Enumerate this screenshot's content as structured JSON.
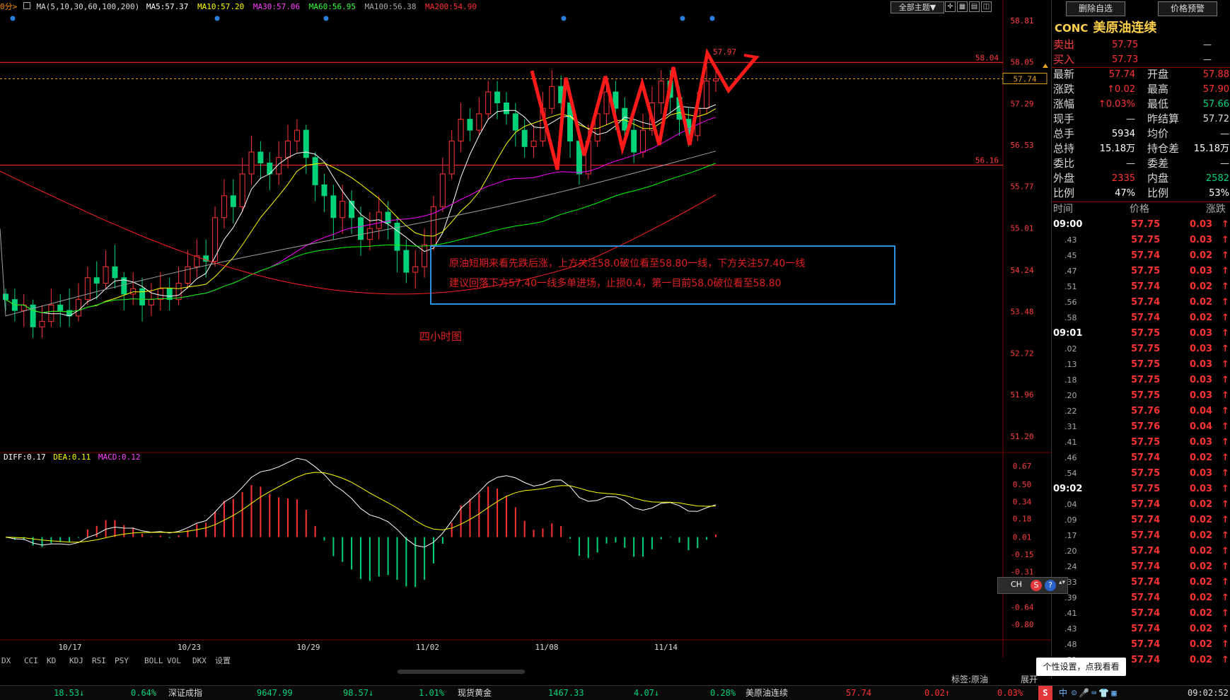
{
  "header": {
    "period_fragment": "0分",
    "ma_label": "MA(5,10,30,60,100,200)",
    "ma5": "MA5:57.37",
    "ma10": "MA10:57.20",
    "ma30": "MA30:57.06",
    "ma60": "MA60:56.95",
    "ma100": "MA100:56.38",
    "ma200": "MA200:54.90",
    "theme_button": "全部主题▼"
  },
  "annotation": {
    "line1": "原油短期来看先跌后涨，上方关注58.0破位看至58.80一线，下方关注57.40一线",
    "line2": "建议回落下方57.40一线多单进场，止损0.4，第一目前58.0破位看至58.80",
    "chart_label": "四小时图"
  },
  "colors": {
    "up": "#ff3232",
    "down": "#00d27a",
    "ma5": "#ffffff",
    "ma10": "#ffff00",
    "ma30": "#ff00ff",
    "ma60": "#00ff00",
    "ma100": "#a0a0a0",
    "ma200": "#ff2020",
    "axis_text": "#ff3c3c",
    "annotation_border": "#2a8fe0"
  },
  "chart_data": [
    {
      "type": "candlestick",
      "title": "",
      "x_tick_labels": [
        "10/17",
        "10/23",
        "10/29",
        "11/02",
        "11/08",
        "11/14"
      ],
      "y_tick_labels": [
        "58.81",
        "58.05",
        "57.29",
        "56.53",
        "55.77",
        "55.01",
        "54.24",
        "53.48",
        "52.72",
        "51.96",
        "51.20"
      ],
      "ylim": [
        50.9,
        58.95
      ],
      "current_price_label": "57.74",
      "h_lines": [
        {
          "label": "58.04",
          "value": 58.04
        },
        {
          "label": "56.16",
          "value": 56.16
        }
      ],
      "peak_label": "57.97",
      "candles": [
        [
          53.8,
          53.7,
          53.9,
          53.5
        ],
        [
          53.7,
          53.5,
          53.9,
          53.3
        ],
        [
          53.5,
          53.6,
          53.8,
          53.2
        ],
        [
          53.6,
          53.2,
          53.7,
          53.0
        ],
        [
          53.2,
          53.3,
          53.6,
          53.0
        ],
        [
          53.3,
          53.6,
          53.9,
          53.2
        ],
        [
          53.6,
          53.5,
          53.8,
          53.2
        ],
        [
          53.5,
          53.4,
          53.9,
          53.2
        ],
        [
          53.4,
          53.7,
          54.0,
          53.3
        ],
        [
          53.7,
          54.1,
          54.3,
          53.6
        ],
        [
          54.1,
          54.0,
          54.4,
          53.7
        ],
        [
          54.0,
          54.3,
          54.6,
          53.9
        ],
        [
          54.3,
          54.1,
          54.7,
          53.9
        ],
        [
          54.1,
          53.8,
          54.2,
          53.5
        ],
        [
          53.8,
          53.9,
          54.2,
          53.6
        ],
        [
          53.9,
          53.6,
          54.1,
          53.3
        ],
        [
          53.6,
          53.7,
          54.0,
          53.4
        ],
        [
          53.7,
          53.9,
          54.2,
          53.5
        ],
        [
          53.9,
          53.7,
          54.1,
          53.5
        ],
        [
          53.7,
          54.0,
          54.3,
          53.6
        ],
        [
          54.0,
          54.3,
          54.6,
          53.9
        ],
        [
          54.3,
          54.5,
          54.8,
          54.1
        ],
        [
          54.5,
          54.4,
          54.8,
          54.1
        ],
        [
          54.4,
          55.2,
          55.4,
          54.3
        ],
        [
          55.2,
          55.6,
          55.9,
          55.0
        ],
        [
          55.6,
          55.4,
          55.9,
          55.1
        ],
        [
          55.4,
          56.0,
          56.3,
          55.3
        ],
        [
          56.0,
          56.4,
          56.7,
          55.8
        ],
        [
          56.4,
          56.2,
          56.6,
          55.9
        ],
        [
          56.2,
          56.0,
          56.4,
          55.7
        ],
        [
          56.0,
          56.3,
          56.6,
          55.8
        ],
        [
          56.3,
          56.6,
          56.9,
          56.1
        ],
        [
          56.6,
          56.8,
          57.0,
          56.4
        ],
        [
          56.8,
          56.3,
          56.9,
          56.0
        ],
        [
          56.3,
          55.8,
          56.4,
          55.5
        ],
        [
          55.8,
          55.6,
          56.0,
          55.3
        ],
        [
          55.6,
          55.2,
          55.8,
          54.8
        ],
        [
          55.2,
          55.5,
          55.8,
          54.9
        ],
        [
          55.5,
          55.2,
          55.7,
          54.9
        ],
        [
          55.2,
          54.8,
          55.4,
          54.5
        ],
        [
          54.8,
          55.0,
          55.3,
          54.6
        ],
        [
          55.0,
          55.3,
          55.6,
          54.8
        ],
        [
          55.3,
          55.1,
          55.5,
          54.8
        ],
        [
          55.1,
          54.6,
          55.2,
          54.2
        ],
        [
          54.6,
          54.2,
          54.8,
          54.0
        ],
        [
          54.2,
          54.3,
          54.6,
          53.9
        ],
        [
          54.3,
          54.7,
          55.0,
          54.1
        ],
        [
          54.7,
          55.4,
          55.6,
          54.6
        ],
        [
          55.4,
          56.0,
          56.3,
          55.3
        ],
        [
          56.0,
          56.6,
          56.8,
          55.9
        ],
        [
          56.6,
          57.0,
          57.3,
          56.4
        ],
        [
          57.0,
          56.8,
          57.2,
          56.6
        ],
        [
          56.8,
          57.1,
          57.4,
          56.7
        ],
        [
          57.1,
          57.5,
          57.7,
          57.0
        ],
        [
          57.5,
          57.3,
          57.7,
          57.0
        ],
        [
          57.3,
          57.1,
          57.5,
          56.9
        ],
        [
          57.1,
          56.8,
          57.3,
          56.5
        ],
        [
          56.8,
          56.5,
          57.0,
          56.3
        ],
        [
          56.5,
          56.6,
          56.9,
          56.3
        ],
        [
          56.6,
          57.2,
          57.5,
          56.5
        ],
        [
          57.2,
          57.6,
          57.9,
          57.1
        ],
        [
          57.6,
          57.3,
          57.8,
          57.0
        ],
        [
          57.3,
          56.6,
          57.5,
          56.3
        ],
        [
          56.6,
          56.0,
          56.8,
          55.8
        ],
        [
          56.0,
          56.6,
          56.9,
          55.9
        ],
        [
          56.6,
          57.1,
          57.3,
          56.5
        ],
        [
          57.1,
          57.5,
          57.8,
          56.9
        ],
        [
          57.5,
          57.2,
          57.7,
          56.8
        ],
        [
          57.2,
          56.8,
          57.4,
          56.5
        ],
        [
          56.8,
          56.4,
          57.0,
          56.2
        ],
        [
          56.4,
          56.8,
          57.1,
          56.3
        ],
        [
          56.8,
          57.3,
          57.6,
          56.7
        ],
        [
          57.3,
          57.7,
          57.9,
          57.1
        ],
        [
          57.7,
          57.4,
          57.9,
          57.1
        ],
        [
          57.4,
          57.0,
          57.6,
          56.7
        ],
        [
          57.0,
          56.7,
          57.2,
          56.5
        ],
        [
          56.7,
          57.2,
          57.5,
          56.6
        ],
        [
          57.2,
          57.7,
          57.97,
          57.1
        ],
        [
          57.7,
          57.74,
          57.9,
          57.5
        ]
      ]
    },
    {
      "type": "macd",
      "title": "",
      "diff_label": "DIFF:0.17",
      "dea_label": "DEA:0.11",
      "macd_label": "MACD:0.12",
      "y_tick_labels": [
        "0.67",
        "0.50",
        "0.34",
        "0.18",
        "0.01",
        "-0.15",
        "-0.31",
        "-0.47",
        "-0.64",
        "-0.80"
      ],
      "ylim": [
        -0.88,
        0.73
      ]
    }
  ],
  "tabs": [
    "DX",
    "CCI",
    "KD",
    "KDJ",
    "RSI",
    "PSY",
    "BOLL",
    "VOL",
    "DKX",
    "设置"
  ],
  "panel": {
    "btn_delete": "删除自选",
    "btn_alert": "价格预警",
    "code": "CONC",
    "name": "美原油连续",
    "sell_label": "卖出",
    "sell_price": "57.75",
    "sell_vol": "—",
    "buy_label": "买入",
    "buy_price": "57.73",
    "buy_vol": "—",
    "rows": [
      {
        "l1": "最新",
        "v1": "57.74",
        "c1": "#ff3232",
        "l2": "开盘",
        "v2": "57.88",
        "c2": "#ff3232"
      },
      {
        "l1": "涨跌",
        "v1": "↑0.02",
        "c1": "#ff3232",
        "l2": "最高",
        "v2": "57.90",
        "c2": "#ff3232"
      },
      {
        "l1": "涨幅",
        "v1": "↑0.03%",
        "c1": "#ff3232",
        "l2": "最低",
        "v2": "57.66",
        "c2": "#00d27a"
      },
      {
        "l1": "现手",
        "v1": "—",
        "c1": "#dddddd",
        "l2": "昨结算",
        "v2": "57.72",
        "c2": "#dddddd"
      },
      {
        "l1": "总手",
        "v1": "5934",
        "c1": "#ffffff",
        "l2": "均价",
        "v2": "—",
        "c2": "#dddddd"
      },
      {
        "l1": "总持",
        "v1": "15.18万",
        "c1": "#ffffff",
        "l2": "持仓差",
        "v2": "15.18万",
        "c2": "#ffffff"
      },
      {
        "l1": "委比",
        "v1": "—",
        "c1": "#dddddd",
        "l2": "委差",
        "v2": "—",
        "c2": "#dddddd"
      },
      {
        "l1": "外盘",
        "v1": "2335",
        "c1": "#ff3232",
        "l2": "内盘",
        "v2": "2582",
        "c2": "#00d27a"
      },
      {
        "l1": "比例",
        "v1": "47%",
        "c1": "#ffffff",
        "l2": "比例",
        "v2": "53%",
        "c2": "#ffffff"
      }
    ],
    "tick_header": {
      "time": "时间",
      "price": "价格",
      "change": "涨跌"
    },
    "ticks": [
      {
        "t": "09:00",
        "p": "57.75",
        "c": "0.03"
      },
      {
        "t": ".43",
        "p": "57.75",
        "c": "0.03"
      },
      {
        "t": ".45",
        "p": "57.74",
        "c": "0.02"
      },
      {
        "t": ".47",
        "p": "57.75",
        "c": "0.03"
      },
      {
        "t": ".51",
        "p": "57.74",
        "c": "0.02"
      },
      {
        "t": ".56",
        "p": "57.74",
        "c": "0.02"
      },
      {
        "t": ".58",
        "p": "57.74",
        "c": "0.02"
      },
      {
        "t": "09:01",
        "p": "57.75",
        "c": "0.03"
      },
      {
        "t": ".02",
        "p": "57.75",
        "c": "0.03"
      },
      {
        "t": ".13",
        "p": "57.75",
        "c": "0.03"
      },
      {
        "t": ".18",
        "p": "57.75",
        "c": "0.03"
      },
      {
        "t": ".20",
        "p": "57.75",
        "c": "0.03"
      },
      {
        "t": ".22",
        "p": "57.76",
        "c": "0.04"
      },
      {
        "t": ".31",
        "p": "57.76",
        "c": "0.04"
      },
      {
        "t": ".41",
        "p": "57.75",
        "c": "0.03"
      },
      {
        "t": ".46",
        "p": "57.74",
        "c": "0.02"
      },
      {
        "t": ".54",
        "p": "57.75",
        "c": "0.03"
      },
      {
        "t": "09:02",
        "p": "57.75",
        "c": "0.03"
      },
      {
        "t": ".04",
        "p": "57.74",
        "c": "0.02"
      },
      {
        "t": ".09",
        "p": "57.74",
        "c": "0.02"
      },
      {
        "t": ".17",
        "p": "57.74",
        "c": "0.02"
      },
      {
        "t": ".20",
        "p": "57.74",
        "c": "0.02"
      },
      {
        "t": ".24",
        "p": "57.74",
        "c": "0.02"
      },
      {
        "t": ".33",
        "p": "57.74",
        "c": "0.02"
      },
      {
        "t": ".39",
        "p": "57.74",
        "c": "0.02"
      },
      {
        "t": ".41",
        "p": "57.74",
        "c": "0.02"
      },
      {
        "t": ".43",
        "p": "57.74",
        "c": "0.02"
      },
      {
        "t": ".48",
        "p": "57.74",
        "c": "0.02"
      },
      {
        "t": ".51",
        "p": "57.74",
        "c": "0.02"
      }
    ],
    "expand_label": "展开",
    "tag_label": "标签:原油",
    "ime_label": "CH",
    "tooltip": "个性设置，点我看看"
  },
  "bottom": {
    "v1": "18.53↓",
    "v2": "0.64%",
    "name2": "深证成指",
    "v3": "9647.99",
    "v4": "98.57↓",
    "v5": "1.01%",
    "name3": "现货黄金",
    "v6": "1467.33",
    "v7": "4.07↓",
    "v8": "0.28%",
    "name4": "美原油连续",
    "v9": "57.74",
    "v10": "0.02↑",
    "v11": "0.03%",
    "ime": "中",
    "time": "09:02:52"
  }
}
